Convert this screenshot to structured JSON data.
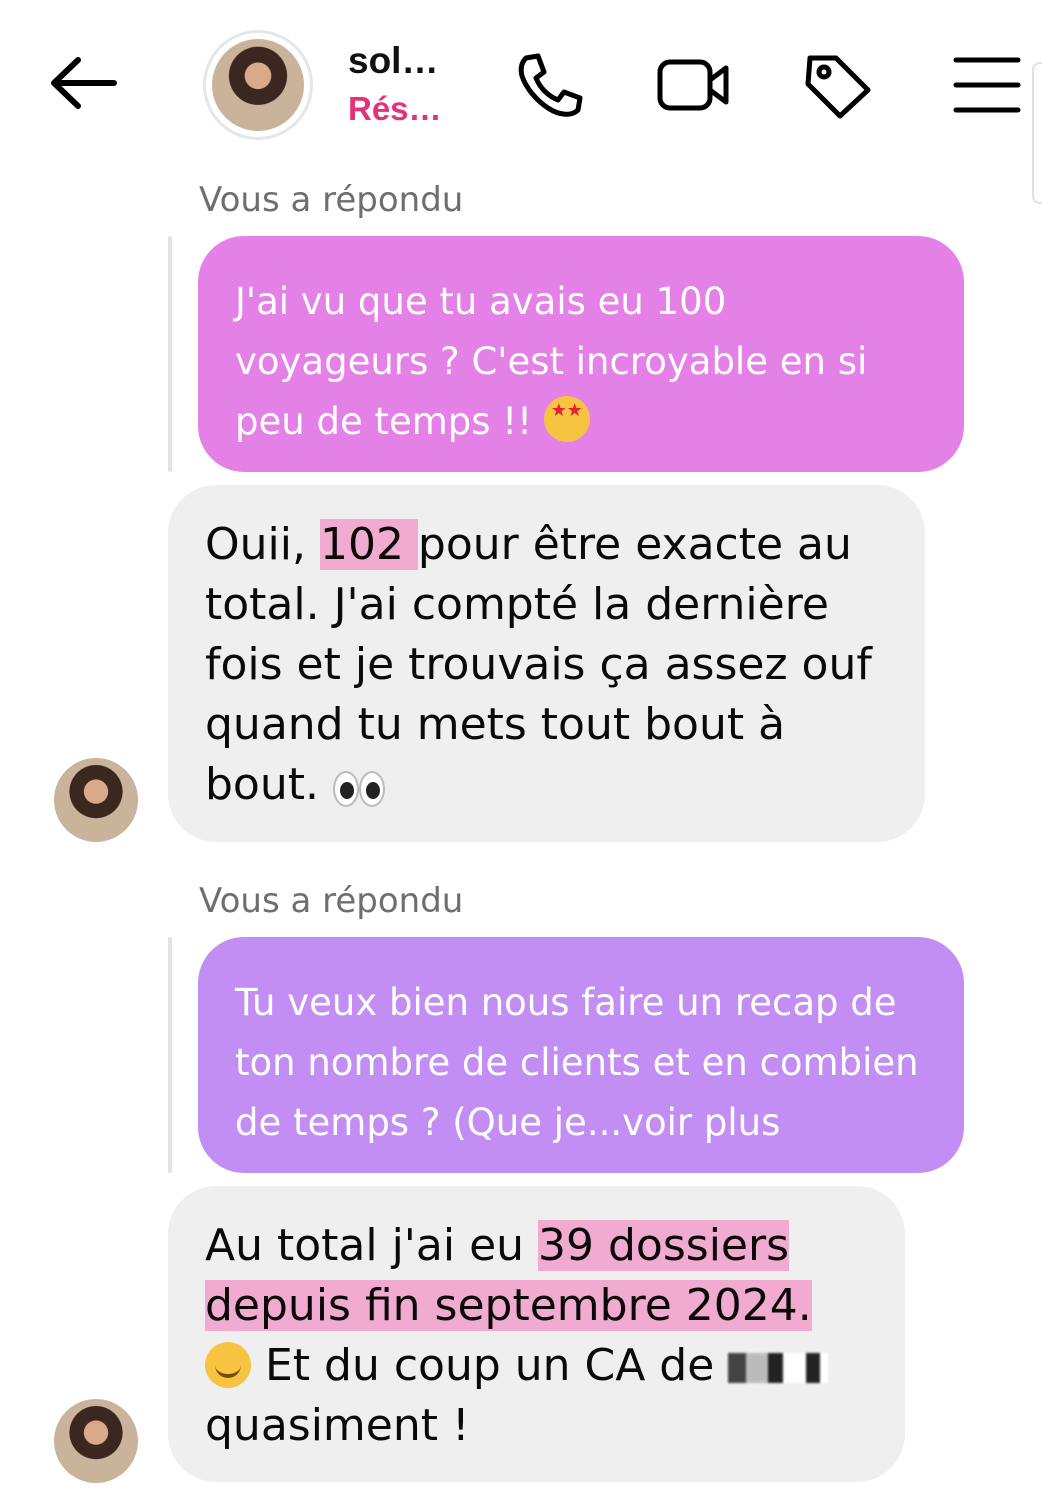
{
  "header": {
    "contact_name": "sol…",
    "contact_status": "Rés…",
    "icons": [
      "back-arrow-icon",
      "phone-icon",
      "video-icon",
      "tag-icon",
      "menu-icon"
    ]
  },
  "thread": {
    "reply_label_1": "Vous a répondu",
    "quoted_1": "J'ai vu que tu avais eu 100 voyageurs ? C'est incroyable en si peu de temps !!",
    "reply_1": {
      "pre": "Ouii, ",
      "highlight": "102 ",
      "post": "pour être exacte au total. J'ai compté la dernière fois et je trouvais ça assez ouf quand tu mets tout bout à bout."
    },
    "reply_label_2": "Vous a répondu",
    "quoted_2": "Tu veux bien nous faire un recap de ton nombre de clients et en combien de temps ? (Que je...voir plus",
    "reply_2": {
      "pre": "Au total j'ai eu ",
      "highlight_1": "39 dossiers",
      "highlight_2": "depuis fin septembre 2024.",
      "mid": " Et du coup un CA de ",
      "post": " quasiment !"
    }
  },
  "colors": {
    "status_pink": "#e4327a",
    "quoted_1_bg": "#e481e6",
    "quoted_2_bg": "#c28ef3",
    "incoming_bg": "#efefef",
    "highlight": "#f1aad0"
  }
}
